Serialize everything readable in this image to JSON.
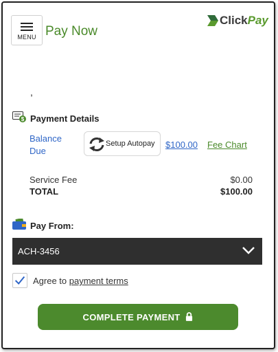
{
  "header": {
    "menu_label": "MENU",
    "title": "Pay Now",
    "logo": {
      "text_a": "Click",
      "text_b": "Pay"
    }
  },
  "placeholder_text": ",",
  "payment_details": {
    "title": "Payment Details",
    "balance_label_line1": "Balance",
    "balance_label_line2": "Due",
    "autopay_label": "Setup Autopay",
    "amount": "$100.00",
    "fee_chart_label": "Fee Chart",
    "service_fee_label": "Service Fee",
    "service_fee_value": "$0.00",
    "total_label": "TOTAL",
    "total_value": "$100.00"
  },
  "pay_from": {
    "title": "Pay From:",
    "selected_account": "ACH-3456"
  },
  "agreement": {
    "prefix": "Agree to ",
    "link": "payment terms",
    "checked": true
  },
  "submit": {
    "label": "COMPLETE PAYMENT",
    "icon": "lock-icon"
  },
  "colors": {
    "brand_green": "#4c8a2d",
    "title_green": "#4a8a2a",
    "link_blue": "#2f66c7",
    "select_bg": "#2f2f2f"
  }
}
